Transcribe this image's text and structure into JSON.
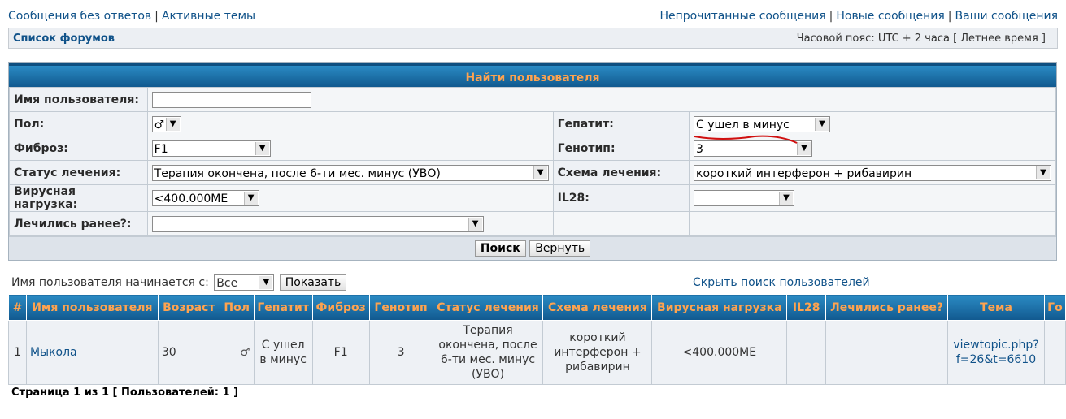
{
  "top_links": {
    "unanswered": "Сообщения без ответов",
    "active": "Активные темы",
    "unread": "Непрочитанные сообщения",
    "new": "Новые сообщения",
    "yours": "Ваши сообщения"
  },
  "navbar": {
    "forums": "Список форумов",
    "timezone": "Часовой пояс: UTC + 2 часа [ Летнее время ]"
  },
  "search": {
    "title": "Найти пользователя",
    "username_label": "Имя пользователя:",
    "username_value": "",
    "gender_label": "Пол:",
    "gender_value": "♂",
    "hepatitis_label": "Гепатит:",
    "hepatitis_value": "С ушел в минус",
    "fibrosis_label": "Фиброз:",
    "fibrosis_value": "F1",
    "genotype_label": "Генотип:",
    "genotype_value": "3",
    "status_label": "Статус лечения:",
    "status_value": "Терапия окончена, после 6-ти мес. минус (УВО)",
    "scheme_label": "Схема лечения:",
    "scheme_value": "короткий интерферон + рибавирин",
    "viral_label": "Вирусная нагрузка:",
    "viral_value": "<400.000МЕ",
    "il28_label": "IL28:",
    "il28_value": "",
    "treated_label": "Лечились ранее?:",
    "treated_value": "",
    "search_btn": "Поиск",
    "reset_btn": "Вернуть"
  },
  "filter": {
    "label": "Имя пользователя начинается с:",
    "value": "Все",
    "show_btn": "Показать",
    "hide_link": "Скрыть поиск пользователей"
  },
  "results": {
    "headers": [
      "#",
      "Имя пользователя",
      "Возраст",
      "Пол",
      "Гепатит",
      "Фиброз",
      "Генотип",
      "Статус лечения",
      "Схема лечения",
      "Вирусная нагрузка",
      "IL28",
      "Лечились ранее?",
      "Тема",
      "Го"
    ],
    "row": {
      "num": "1",
      "user": "Мыкола",
      "age": "30",
      "gender": "♂",
      "hepatitis": "С ушел в минус",
      "fibrosis": "F1",
      "genotype": "3",
      "status": "Терапия окончена, после 6-ти мес. минус (УВО)",
      "scheme": "короткий интерферон + рибавирин",
      "viral": "<400.000МЕ",
      "il28": "",
      "treated": "",
      "topic": "viewtopic.php?f=26&t=6610"
    }
  },
  "footer": "Страница 1 из 1 [ Пользователей: 1 ]",
  "colors": {
    "link": "#105289",
    "header_text": "#ffa34f",
    "header_bg": "#11598f",
    "annotation": "#d01010"
  }
}
